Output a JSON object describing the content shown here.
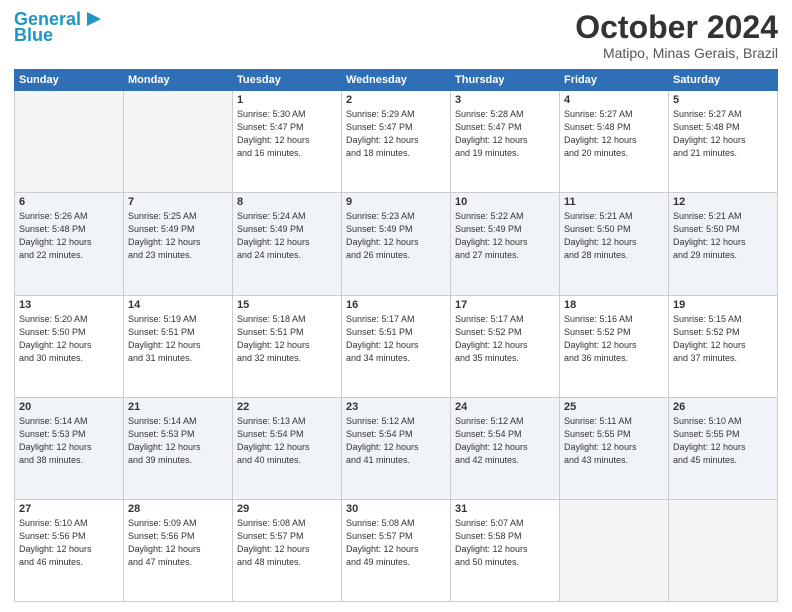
{
  "header": {
    "logo_line1": "General",
    "logo_line2": "Blue",
    "month": "October 2024",
    "location": "Matipo, Minas Gerais, Brazil"
  },
  "days_of_week": [
    "Sunday",
    "Monday",
    "Tuesday",
    "Wednesday",
    "Thursday",
    "Friday",
    "Saturday"
  ],
  "weeks": [
    [
      {
        "day": "",
        "info": ""
      },
      {
        "day": "",
        "info": ""
      },
      {
        "day": "1",
        "info": "Sunrise: 5:30 AM\nSunset: 5:47 PM\nDaylight: 12 hours\nand 16 minutes."
      },
      {
        "day": "2",
        "info": "Sunrise: 5:29 AM\nSunset: 5:47 PM\nDaylight: 12 hours\nand 18 minutes."
      },
      {
        "day": "3",
        "info": "Sunrise: 5:28 AM\nSunset: 5:47 PM\nDaylight: 12 hours\nand 19 minutes."
      },
      {
        "day": "4",
        "info": "Sunrise: 5:27 AM\nSunset: 5:48 PM\nDaylight: 12 hours\nand 20 minutes."
      },
      {
        "day": "5",
        "info": "Sunrise: 5:27 AM\nSunset: 5:48 PM\nDaylight: 12 hours\nand 21 minutes."
      }
    ],
    [
      {
        "day": "6",
        "info": "Sunrise: 5:26 AM\nSunset: 5:48 PM\nDaylight: 12 hours\nand 22 minutes."
      },
      {
        "day": "7",
        "info": "Sunrise: 5:25 AM\nSunset: 5:49 PM\nDaylight: 12 hours\nand 23 minutes."
      },
      {
        "day": "8",
        "info": "Sunrise: 5:24 AM\nSunset: 5:49 PM\nDaylight: 12 hours\nand 24 minutes."
      },
      {
        "day": "9",
        "info": "Sunrise: 5:23 AM\nSunset: 5:49 PM\nDaylight: 12 hours\nand 26 minutes."
      },
      {
        "day": "10",
        "info": "Sunrise: 5:22 AM\nSunset: 5:49 PM\nDaylight: 12 hours\nand 27 minutes."
      },
      {
        "day": "11",
        "info": "Sunrise: 5:21 AM\nSunset: 5:50 PM\nDaylight: 12 hours\nand 28 minutes."
      },
      {
        "day": "12",
        "info": "Sunrise: 5:21 AM\nSunset: 5:50 PM\nDaylight: 12 hours\nand 29 minutes."
      }
    ],
    [
      {
        "day": "13",
        "info": "Sunrise: 5:20 AM\nSunset: 5:50 PM\nDaylight: 12 hours\nand 30 minutes."
      },
      {
        "day": "14",
        "info": "Sunrise: 5:19 AM\nSunset: 5:51 PM\nDaylight: 12 hours\nand 31 minutes."
      },
      {
        "day": "15",
        "info": "Sunrise: 5:18 AM\nSunset: 5:51 PM\nDaylight: 12 hours\nand 32 minutes."
      },
      {
        "day": "16",
        "info": "Sunrise: 5:17 AM\nSunset: 5:51 PM\nDaylight: 12 hours\nand 34 minutes."
      },
      {
        "day": "17",
        "info": "Sunrise: 5:17 AM\nSunset: 5:52 PM\nDaylight: 12 hours\nand 35 minutes."
      },
      {
        "day": "18",
        "info": "Sunrise: 5:16 AM\nSunset: 5:52 PM\nDaylight: 12 hours\nand 36 minutes."
      },
      {
        "day": "19",
        "info": "Sunrise: 5:15 AM\nSunset: 5:52 PM\nDaylight: 12 hours\nand 37 minutes."
      }
    ],
    [
      {
        "day": "20",
        "info": "Sunrise: 5:14 AM\nSunset: 5:53 PM\nDaylight: 12 hours\nand 38 minutes."
      },
      {
        "day": "21",
        "info": "Sunrise: 5:14 AM\nSunset: 5:53 PM\nDaylight: 12 hours\nand 39 minutes."
      },
      {
        "day": "22",
        "info": "Sunrise: 5:13 AM\nSunset: 5:54 PM\nDaylight: 12 hours\nand 40 minutes."
      },
      {
        "day": "23",
        "info": "Sunrise: 5:12 AM\nSunset: 5:54 PM\nDaylight: 12 hours\nand 41 minutes."
      },
      {
        "day": "24",
        "info": "Sunrise: 5:12 AM\nSunset: 5:54 PM\nDaylight: 12 hours\nand 42 minutes."
      },
      {
        "day": "25",
        "info": "Sunrise: 5:11 AM\nSunset: 5:55 PM\nDaylight: 12 hours\nand 43 minutes."
      },
      {
        "day": "26",
        "info": "Sunrise: 5:10 AM\nSunset: 5:55 PM\nDaylight: 12 hours\nand 45 minutes."
      }
    ],
    [
      {
        "day": "27",
        "info": "Sunrise: 5:10 AM\nSunset: 5:56 PM\nDaylight: 12 hours\nand 46 minutes."
      },
      {
        "day": "28",
        "info": "Sunrise: 5:09 AM\nSunset: 5:56 PM\nDaylight: 12 hours\nand 47 minutes."
      },
      {
        "day": "29",
        "info": "Sunrise: 5:08 AM\nSunset: 5:57 PM\nDaylight: 12 hours\nand 48 minutes."
      },
      {
        "day": "30",
        "info": "Sunrise: 5:08 AM\nSunset: 5:57 PM\nDaylight: 12 hours\nand 49 minutes."
      },
      {
        "day": "31",
        "info": "Sunrise: 5:07 AM\nSunset: 5:58 PM\nDaylight: 12 hours\nand 50 minutes."
      },
      {
        "day": "",
        "info": ""
      },
      {
        "day": "",
        "info": ""
      }
    ]
  ]
}
